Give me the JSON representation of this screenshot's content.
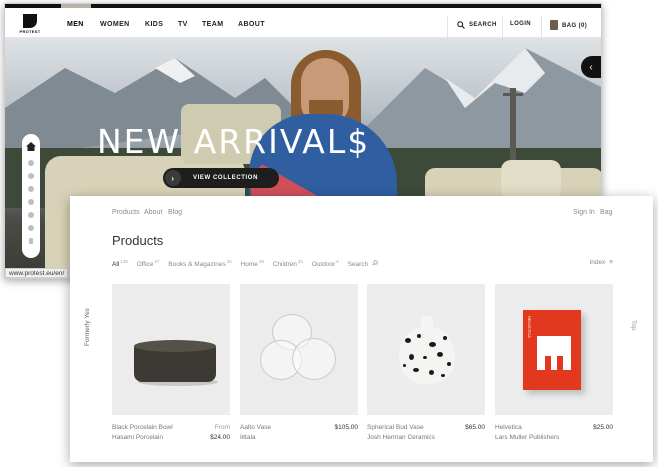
{
  "back_window": {
    "logo_text": "PROTEST",
    "nav": [
      "MEN",
      "WOMEN",
      "KIDS",
      "TV",
      "TEAM",
      "ABOUT"
    ],
    "search_label": "SEARCH",
    "login_label": "LOGIN",
    "bag_label": "BAG (0)",
    "hero_title": "NEW ARRIVAL$",
    "hero_button": "VIEW COLLECTION",
    "status_url": "www.protest.eu/en/"
  },
  "front_window": {
    "nav_left": [
      "Products",
      "About",
      "Blog"
    ],
    "nav_right": [
      "Sign In",
      "Bag"
    ],
    "page_title": "Products",
    "filters": [
      {
        "label": "All",
        "count": "145"
      },
      {
        "label": "Office",
        "count": "27"
      },
      {
        "label": "Books & Magazines",
        "count": "36"
      },
      {
        "label": "Home",
        "count": "48"
      },
      {
        "label": "Children",
        "count": "23"
      },
      {
        "label": "Outdoor",
        "count": "9"
      }
    ],
    "search_label": "Search",
    "index_label": "Index",
    "side_label": "Formerly Yes",
    "top_label": "Top",
    "products": [
      {
        "name": "Black Porcelain Bowl",
        "maker": "Hasami Porcelain",
        "from": "From",
        "price": "$24.00"
      },
      {
        "name": "Aalto Vase",
        "maker": "Iittala",
        "price": "$105.00"
      },
      {
        "name": "Spherical Bud Vase",
        "maker": "Josh Herman Ceramics",
        "price": "$65.00"
      },
      {
        "name": "Helvetica",
        "maker": "Lars Muller Publishers",
        "price": "$25.00"
      }
    ],
    "book_spine": "HELVETICA",
    "book_letter": "H"
  },
  "colors": {
    "hoodie_blue": "#2f5fa1",
    "hoodie_red": "#d0505a",
    "book_red": "#e2391e",
    "card_bg": "#ececec"
  }
}
